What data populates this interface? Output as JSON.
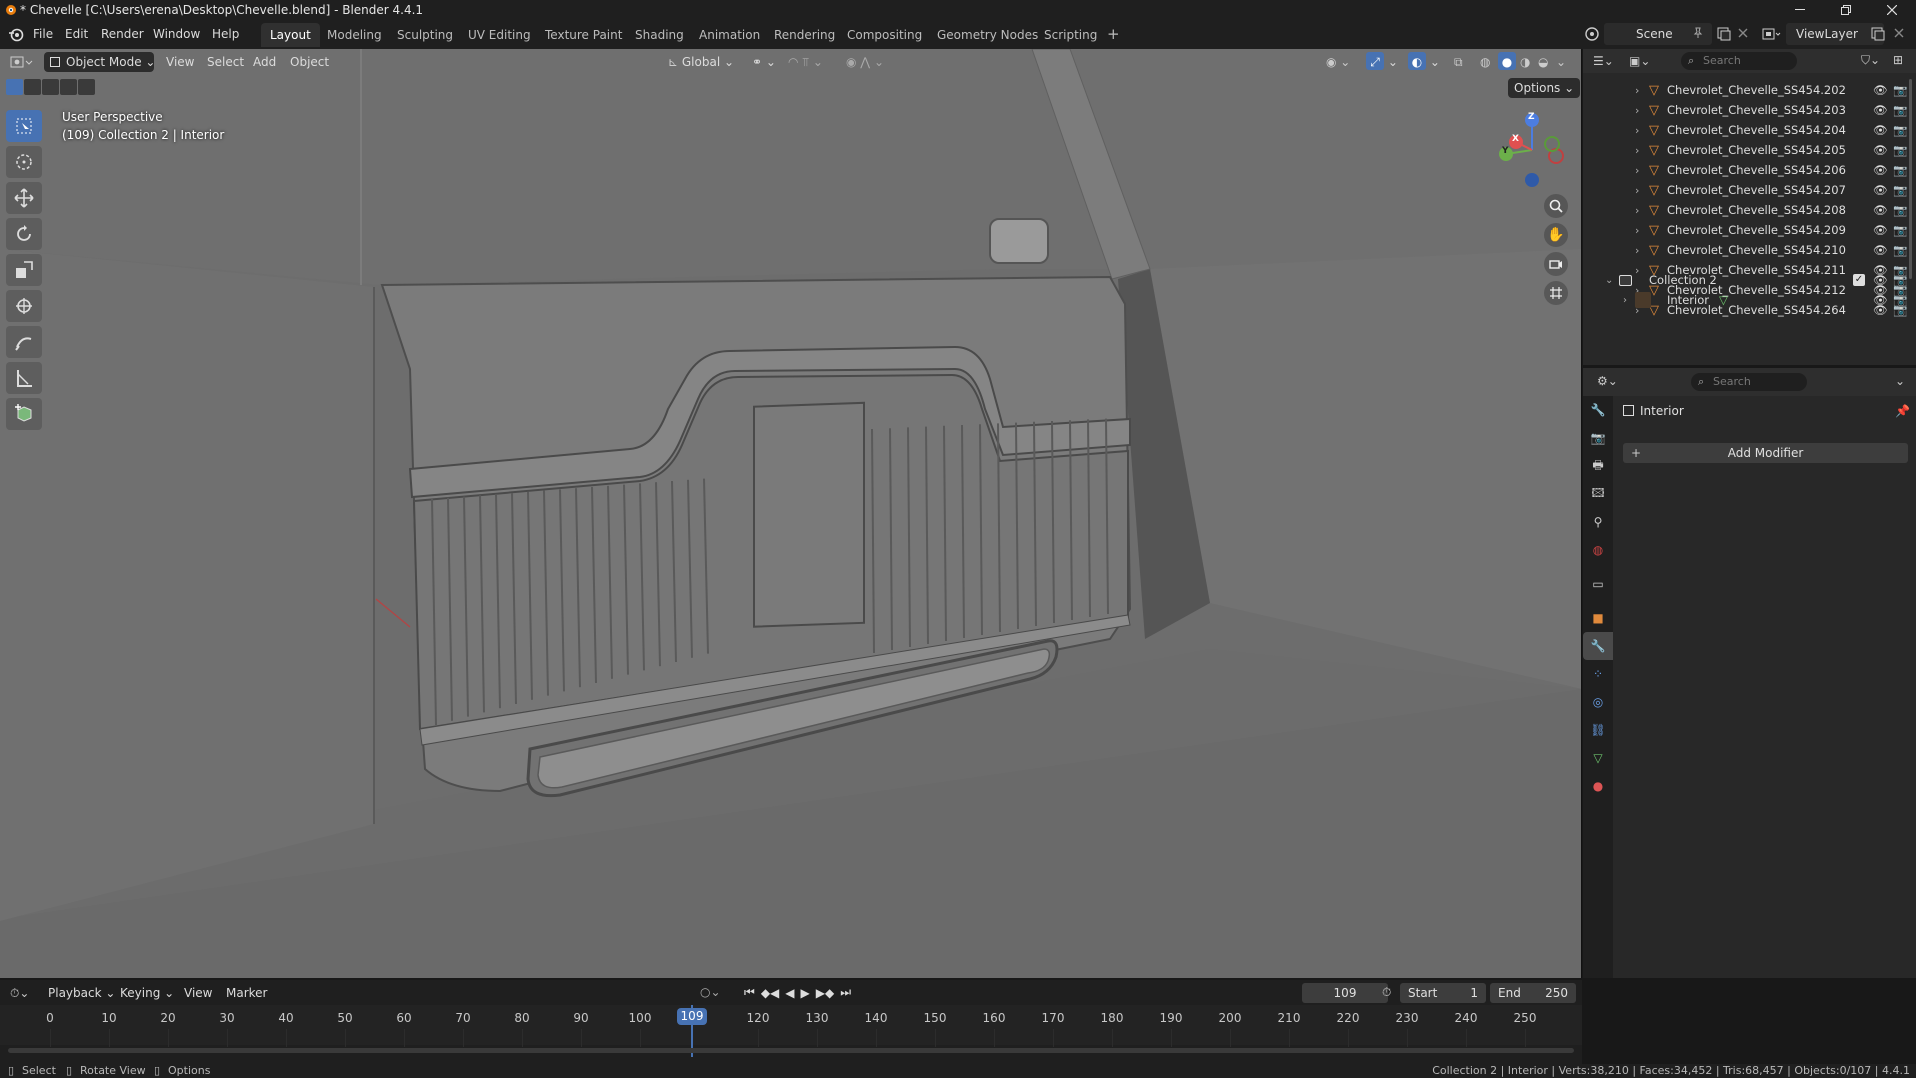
{
  "window": {
    "title": "* Chevelle [C:\\Users\\erena\\Desktop\\Chevelle.blend] - Blender 4.4.1"
  },
  "menu": [
    "File",
    "Edit",
    "Render",
    "Window",
    "Help"
  ],
  "workspaces": [
    "Layout",
    "Modeling",
    "Sculpting",
    "UV Editing",
    "Texture Paint",
    "Shading",
    "Animation",
    "Rendering",
    "Compositing",
    "Geometry Nodes",
    "Scripting"
  ],
  "active_workspace": "Layout",
  "scene": {
    "name": "Scene",
    "view_layer": "ViewLayer"
  },
  "viewport_header": {
    "mode": "Object Mode",
    "menus": [
      "View",
      "Select",
      "Add",
      "Object"
    ],
    "transform_orientation": "Global",
    "options": "Options"
  },
  "viewport_info": {
    "perspective": "User Perspective",
    "collection_line": "(109) Collection 2 | Interior"
  },
  "gizmo_axes": {
    "z": "Z",
    "y": "Y",
    "x": "X"
  },
  "outliner": {
    "search_placeholder": "Search",
    "items": [
      "Chevrolet_Chevelle_SS454.202",
      "Chevrolet_Chevelle_SS454.203",
      "Chevrolet_Chevelle_SS454.204",
      "Chevrolet_Chevelle_SS454.205",
      "Chevrolet_Chevelle_SS454.206",
      "Chevrolet_Chevelle_SS454.207",
      "Chevrolet_Chevelle_SS454.208",
      "Chevrolet_Chevelle_SS454.209",
      "Chevrolet_Chevelle_SS454.210",
      "Chevrolet_Chevelle_SS454.211",
      "Chevrolet_Chevelle_SS454.212",
      "Chevrolet_Chevelle_SS454.264"
    ],
    "collection": "Collection 2",
    "collection_child": "Interior"
  },
  "properties": {
    "search_placeholder": "Search",
    "object_name": "Interior",
    "add_modifier": "Add Modifier"
  },
  "timeline": {
    "menus": [
      "Playback",
      "Keying",
      "View",
      "Marker"
    ],
    "current_frame": "109",
    "start_label": "Start",
    "start": "1",
    "end_label": "End",
    "end": "250",
    "ticks": [
      "0",
      "10",
      "20",
      "30",
      "40",
      "50",
      "60",
      "70",
      "80",
      "90",
      "100",
      "120",
      "130",
      "140",
      "150",
      "160",
      "170",
      "180",
      "190",
      "200",
      "210",
      "220",
      "230",
      "240",
      "250"
    ]
  },
  "statusbar": {
    "select": "Select",
    "rotate": "Rotate View",
    "options": "Options",
    "stats": "Collection 2 | Interior | Verts:38,210 | Faces:34,452 | Tris:68,457 | Objects:0/107 | 4.4.1"
  },
  "colors": {
    "accent": "#4772b3",
    "mesh_orange": "#e08a3c",
    "active_tab": "#303030"
  }
}
